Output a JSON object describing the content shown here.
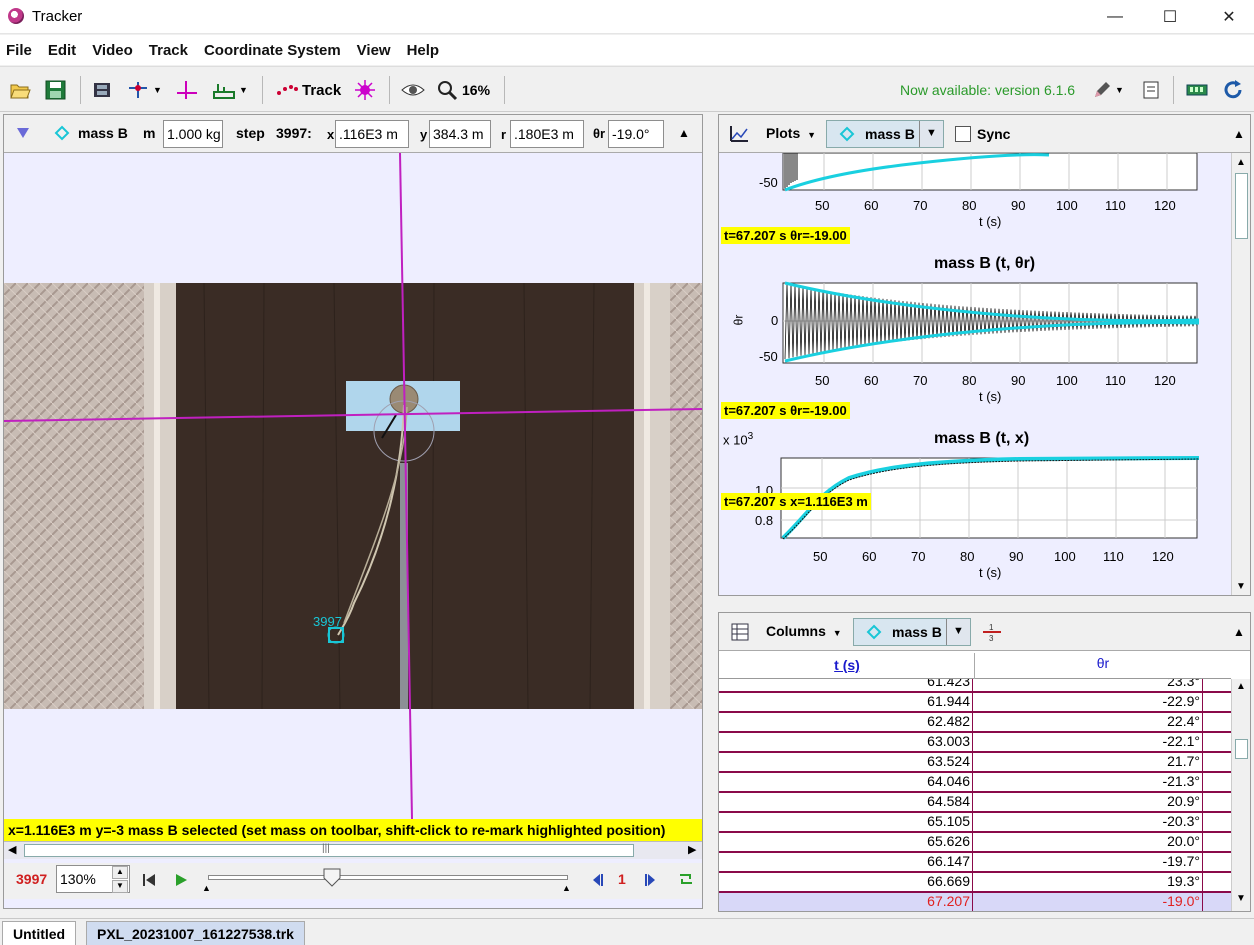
{
  "window": {
    "title": "Tracker",
    "minimize": "—",
    "maximize": "☐",
    "close": "✕"
  },
  "menu": [
    "File",
    "Edit",
    "Video",
    "Track",
    "Coordinate System",
    "View",
    "Help"
  ],
  "toolbar": {
    "track_label": "Track",
    "zoom": "16%",
    "update_notice": "Now available: version 6.1.6"
  },
  "trackbar": {
    "track_name": "mass B",
    "mass_label": "m",
    "mass_value": "1.000 kg",
    "step_label": "step",
    "step_value": "3997:",
    "x_label": "x",
    "x_value": ".116E3 m",
    "y_label": "y",
    "y_value": "384.3 m",
    "r_label": "r",
    "r_value": ".180E3 m",
    "theta_label": "θr",
    "theta_value": "-19.0°"
  },
  "video": {
    "point_label": "3997"
  },
  "status": {
    "message": "x=1.116E3 m  y=-3 mass B selected (set mass on toolbar, shift-click to re-mark highlighted position)"
  },
  "player": {
    "frame": "3997",
    "zoom": "130%",
    "step_size": "1"
  },
  "plots": {
    "button": "Plots",
    "track": "mass B",
    "sync": "Sync",
    "plot1": {
      "readout": "t=67.207 s  θr=-19.00",
      "y_tick_bottom": "-50",
      "x_ticks": [
        "50",
        "60",
        "70",
        "80",
        "90",
        "100",
        "110",
        "120"
      ],
      "x_label": "t (s)"
    },
    "plot2": {
      "title": "mass B (t, θr)",
      "readout": "t=67.207 s  θr=-19.00",
      "y_label": "θr",
      "y_ticks": [
        "0",
        "-50"
      ],
      "x_ticks": [
        "50",
        "60",
        "70",
        "80",
        "90",
        "100",
        "110",
        "120"
      ],
      "x_label": "t (s)"
    },
    "plot3": {
      "title": "mass B (t, x)",
      "exponent": "x 10",
      "exponent_power": "3",
      "readout": "t=67.207 s  x=1.116E3 m",
      "y_ticks": [
        "1.0",
        "0.8"
      ],
      "x_ticks": [
        "50",
        "60",
        "70",
        "80",
        "90",
        "100",
        "110",
        "120"
      ],
      "x_label": "t (s)"
    }
  },
  "table": {
    "button": "Columns",
    "track": "mass B",
    "col1": "t (s)",
    "col2": "θr",
    "rows": [
      [
        "61.423",
        "23.3°"
      ],
      [
        "61.944",
        "-22.9°"
      ],
      [
        "62.482",
        "22.4°"
      ],
      [
        "63.003",
        "-22.1°"
      ],
      [
        "63.524",
        "21.7°"
      ],
      [
        "64.046",
        "-21.3°"
      ],
      [
        "64.584",
        "20.9°"
      ],
      [
        "65.105",
        "-20.3°"
      ],
      [
        "65.626",
        "20.0°"
      ],
      [
        "66.147",
        "-19.7°"
      ],
      [
        "66.669",
        "19.3°"
      ],
      [
        "67.207",
        "-19.0°"
      ]
    ]
  },
  "tabs": [
    "Untitled",
    "PXL_20231007_161227538.trk"
  ]
}
